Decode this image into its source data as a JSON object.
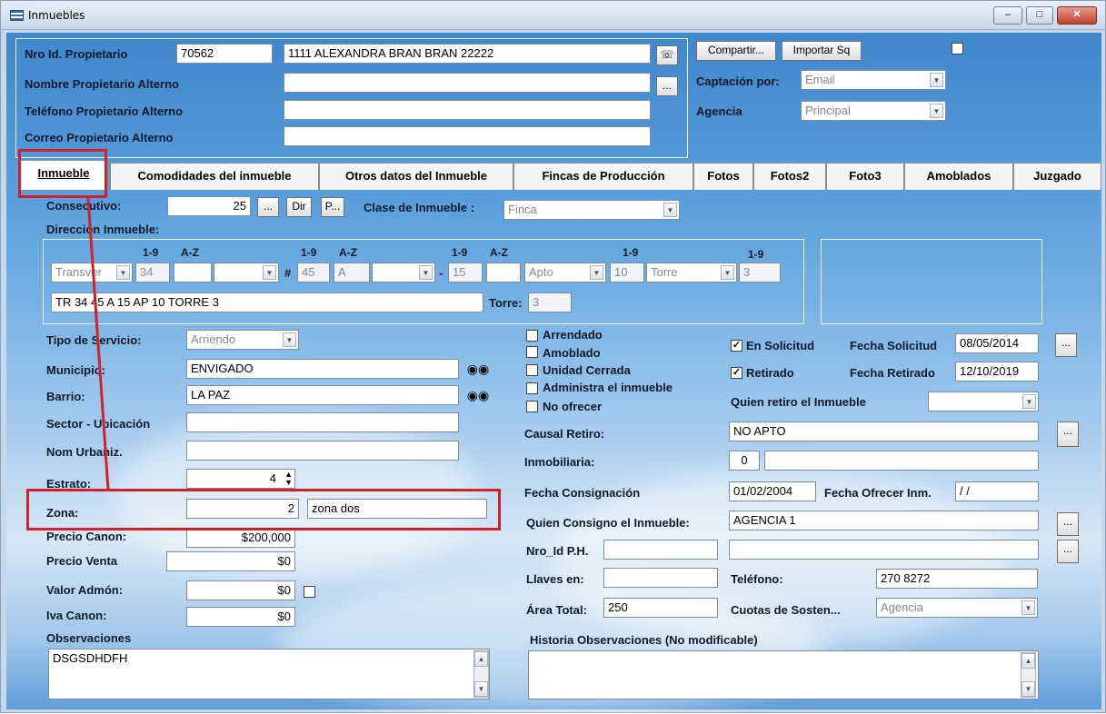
{
  "window": {
    "title": "Inmuebles",
    "min": "–",
    "max": "□",
    "close": "✕"
  },
  "owner": {
    "id_label": "Nro Id. Propietario",
    "id_value": "70562",
    "name_value": "1111 ALEXANDRA BRAN BRAN 22222",
    "alt_name_label": "Nombre Propietario Alterno",
    "alt_phone_label": "Teléfono Propietario Alterno",
    "alt_email_label": "Correo Propietario Alterno",
    "ellipsis": "..."
  },
  "topright": {
    "share_label": "Compartir...",
    "import_label": "Importar Sq",
    "captacion_label": "Captación por:",
    "captacion_value": "Email",
    "agencia_label": "Agencia",
    "agencia_value": "Principal"
  },
  "tabs": [
    "Inmueble",
    "Comodidades del inmueble",
    "Otros datos del Inmueble",
    "Fincas de Producción",
    "Fotos",
    "Fotos2",
    "Foto3",
    "Amoblados",
    "Juzgado"
  ],
  "form": {
    "consecutivo_label": "Consecutivo:",
    "consecutivo_value": "25",
    "btn_dots": "...",
    "btn_dir": "Dir",
    "btn_p": "P...",
    "clase_label": "Clase de Inmueble :",
    "clase_value": "Finca",
    "direccion_label": "Dirección Inmueble:",
    "hint_19": "1-9",
    "hint_az": "A-Z",
    "addr_tipo": "Transver",
    "addr_n1": "34",
    "addr_hash": "#",
    "addr_n2": "45",
    "addr_l2": "A",
    "addr_dash": "-",
    "addr_n3": "15",
    "addr_apto": "Apto",
    "addr_n4": "10",
    "addr_torre": "Torre",
    "addr_n5": "3",
    "addr_full": "TR 34 45 A 15 AP 10 TORRE 3",
    "torre_label": "Torre:",
    "torre_value": "3",
    "tipo_servicio_label": "Tipo de Servicio:",
    "tipo_servicio_value": "Arriendo",
    "municipio_label": "Municipio:",
    "municipio_value": "ENVIGADO",
    "barrio_label": "Barrio:",
    "barrio_value": "LA PAZ",
    "sector_label": "Sector - Ubicación",
    "urbaniz_label": "Nom Urbaniz.",
    "estrato_label": "Estrato:",
    "estrato_value": "4",
    "zona_label": "Zona:",
    "zona_value": "2",
    "zona_name": "zona dos",
    "precio_canon_label": "Precio Canon:",
    "precio_canon_value": "$200,000",
    "precio_venta_label": "Precio Venta",
    "precio_venta_value": "$0",
    "valor_admon_label": "Valor Admón:",
    "valor_admon_value": "$0",
    "iva_canon_label": "Iva Canon:",
    "iva_canon_value": "$0",
    "observaciones_label": "Observaciones",
    "observaciones_value": "DSGSDHDFH",
    "arrendado_label": "Arrendado",
    "amoblado_label": "Amoblado",
    "unidad_cerrada_label": "Unidad Cerrada",
    "administra_label": "Administra el inmueble",
    "no_ofrecer_label": "No ofrecer",
    "en_solicitud_label": "En Solicitud",
    "retirado_label": "Retirado",
    "fecha_solicitud_label": "Fecha Solicitud",
    "fecha_solicitud_value": "08/05/2014",
    "fecha_retirado_label": "Fecha Retirado",
    "fecha_retirado_value": "12/10/2019",
    "quien_retiro_label": "Quien retiro el Inmueble",
    "causal_label": "Causal Retiro:",
    "causal_value": "NO APTO",
    "inmobiliaria_label": "Inmobiliaria:",
    "inmobiliaria_value": "0",
    "fecha_consig_label": "Fecha Consignación",
    "fecha_consig_value": "01/02/2004",
    "fecha_ofrecer_label": "Fecha Ofrecer Inm.",
    "fecha_ofrecer_value": " / /",
    "quien_consigno_label": "Quien Consigno el Inmueble:",
    "quien_consigno_value": "AGENCIA 1",
    "nro_ph_label": "Nro_Id P.H.",
    "llaves_label": "Llaves en:",
    "telefono_label": "Teléfono:",
    "telefono_value": "270 8272",
    "area_label": "Área Total:",
    "area_value": "250",
    "cuotas_label": "Cuotas de Sosten...",
    "cuotas_value": "Agencia",
    "historia_label": "Historia Observaciones (No modificable)",
    "check_mark": "✓",
    "arrow_down": "▼",
    "arrow_up": "▲"
  },
  "colors": {
    "highlight": "#d42028"
  }
}
